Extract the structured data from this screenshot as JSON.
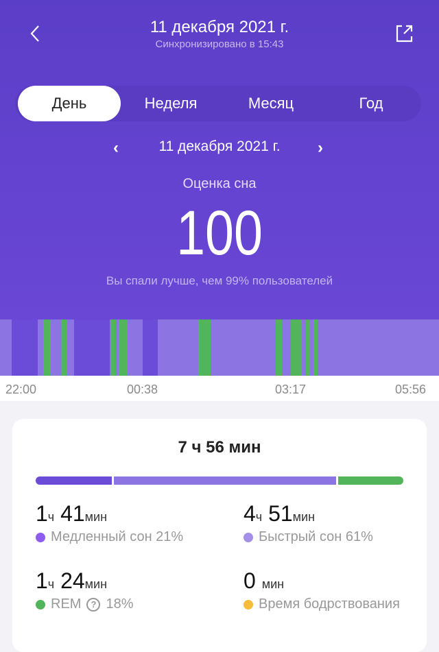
{
  "header": {
    "title": "11 декабря 2021 г.",
    "sync": "Синхронизировано в 15:43",
    "back_icon": "chevron-left-icon",
    "share_icon": "share-icon"
  },
  "tabs": [
    {
      "label": "День",
      "active": true
    },
    {
      "label": "Неделя"
    },
    {
      "label": "Месяц"
    },
    {
      "label": "Год"
    }
  ],
  "date_nav": {
    "date": "11 декабря 2021 г.",
    "prev": "‹",
    "next": "›"
  },
  "score": {
    "label": "Оценка сна",
    "value": "100",
    "note": "Вы спали лучше, чем 99% пользователей"
  },
  "colors": {
    "deep": "#6a4cd8",
    "light": "#8c74e2",
    "rem": "#52b55c",
    "awake": "#f5bd3a",
    "deep_dot": "#8f5cf0",
    "light_dot": "#a58fe8"
  },
  "chart_data": {
    "type": "timeline",
    "start": "22:00",
    "end": "05:56",
    "ticks": [
      "22:00",
      "00:38",
      "03:17",
      "05:56"
    ],
    "default_stage": "light",
    "segments": [
      {
        "start": "22:13",
        "end": "22:41",
        "stage": "deep"
      },
      {
        "start": "22:47",
        "end": "22:55",
        "stage": "rem"
      },
      {
        "start": "23:06",
        "end": "23:13",
        "stage": "rem"
      },
      {
        "start": "23:20",
        "end": "23:59",
        "stage": "deep"
      },
      {
        "start": "00:00",
        "end": "00:06",
        "stage": "rem"
      },
      {
        "start": "00:09",
        "end": "00:18",
        "stage": "rem"
      },
      {
        "start": "00:35",
        "end": "00:51",
        "stage": "deep"
      },
      {
        "start": "01:35",
        "end": "01:48",
        "stage": "rem"
      },
      {
        "start": "02:59",
        "end": "03:06",
        "stage": "rem"
      },
      {
        "start": "03:15",
        "end": "03:27",
        "stage": "rem"
      },
      {
        "start": "03:32",
        "end": "03:36",
        "stage": "rem"
      },
      {
        "start": "03:40",
        "end": "03:44",
        "stage": "rem"
      }
    ]
  },
  "summary": {
    "total": "7 ч 56 мин",
    "stats": [
      {
        "h": "1",
        "hu": "ч",
        "m": "41",
        "mu": "мин",
        "label": "Медленный сон 21%",
        "stage": "deep",
        "pct": 21
      },
      {
        "h": "4",
        "hu": "ч",
        "m": "51",
        "mu": "мин",
        "label": "Быстрый сон 61%",
        "stage": "light",
        "pct": 61
      },
      {
        "h": "1",
        "hu": "ч",
        "m": "24",
        "mu": "мин",
        "label": "REM",
        "pct_label": "18%",
        "stage": "rem",
        "pct": 18
      },
      {
        "h": "",
        "hu": "",
        "m": "0",
        "mu": "мин",
        "label": "Время бодрствования",
        "stage": "awake",
        "pct": 0
      }
    ]
  }
}
